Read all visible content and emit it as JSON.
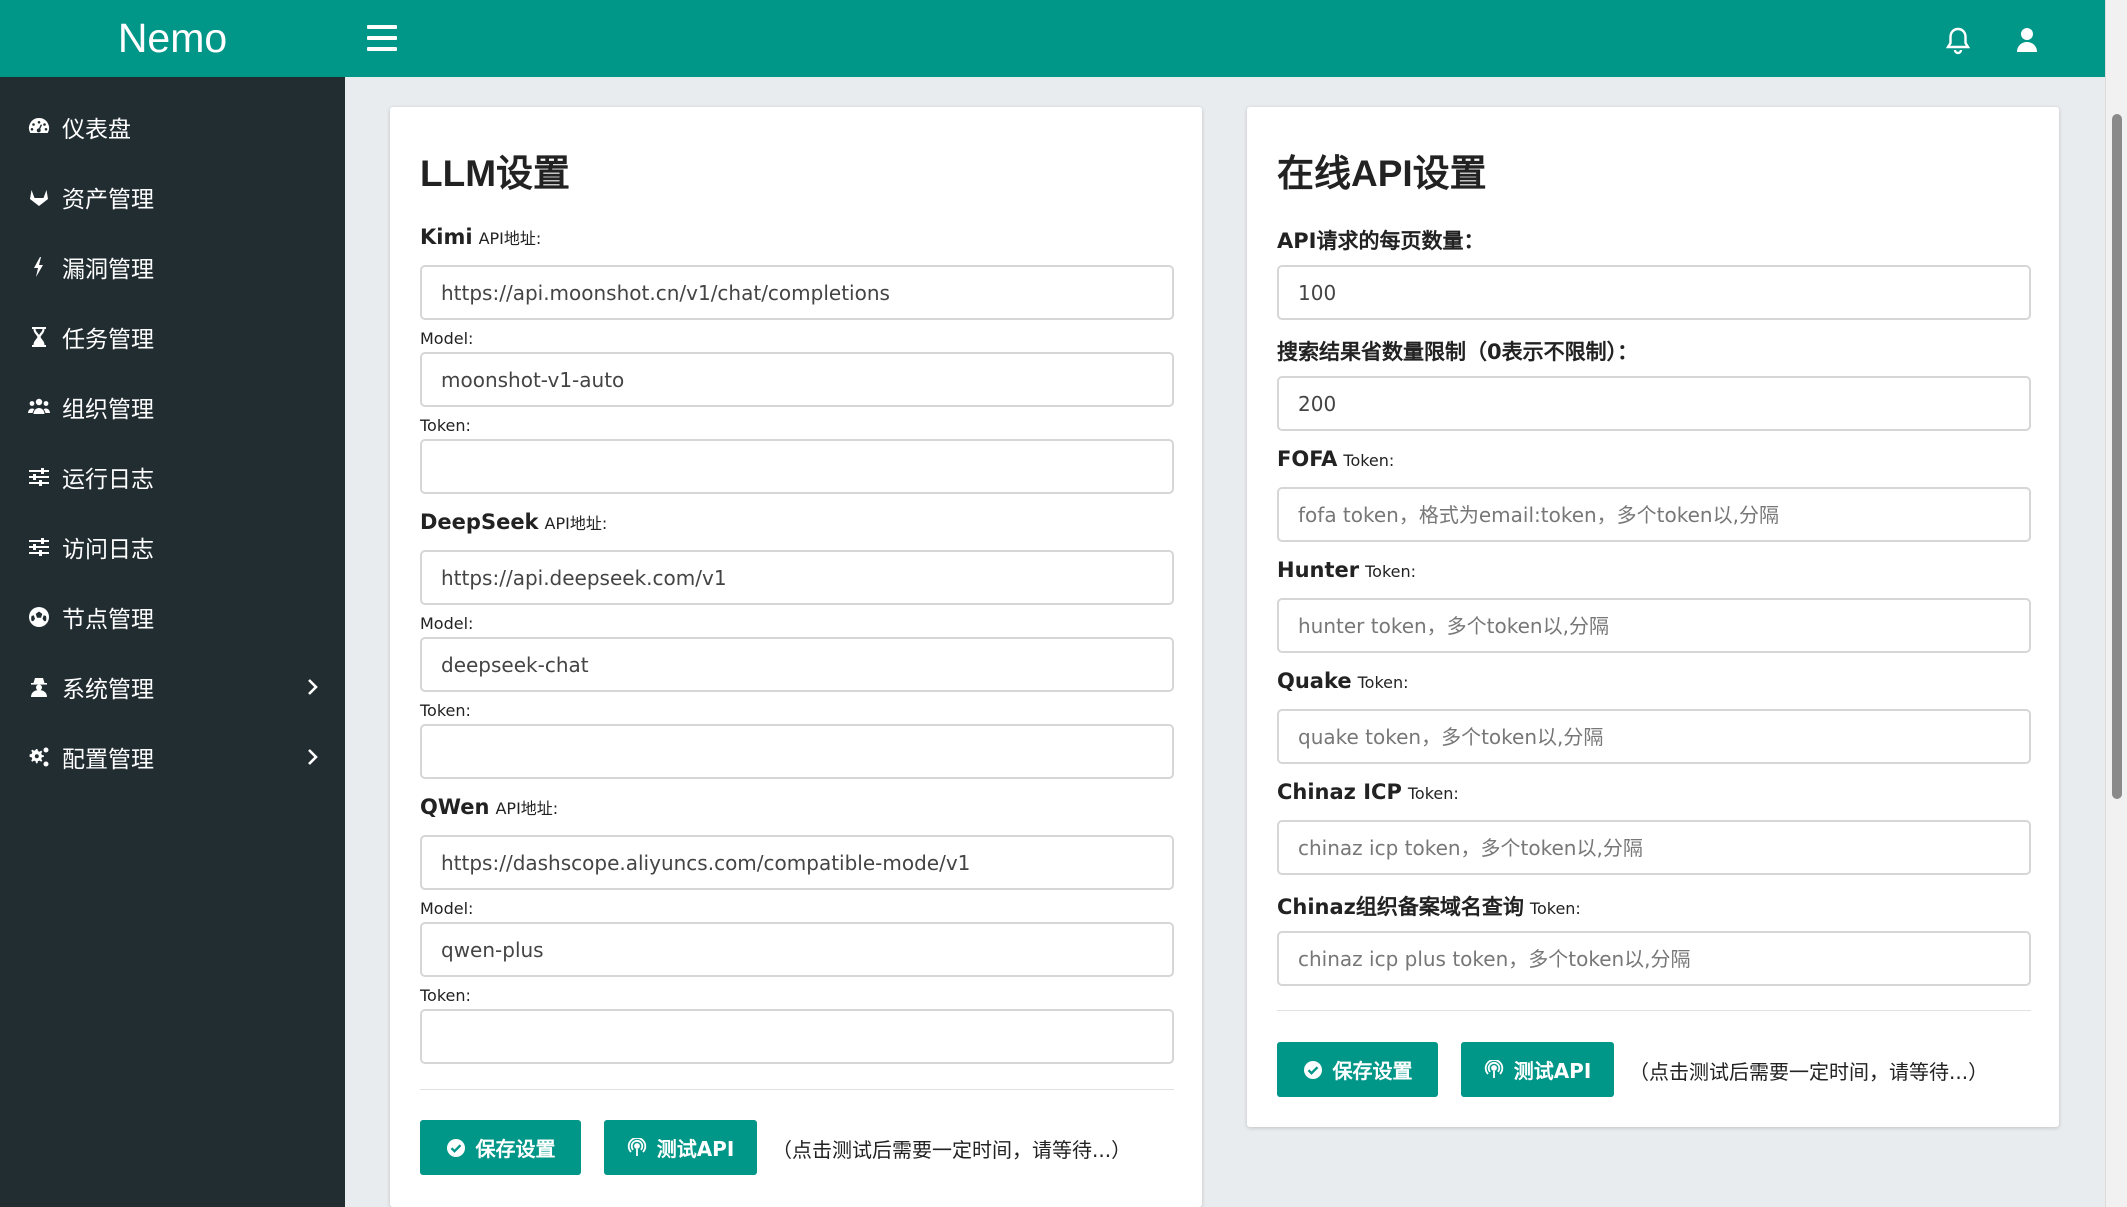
{
  "app": {
    "brand": "Nemo"
  },
  "sidebar": {
    "items": [
      {
        "label": "仪表盘",
        "icon": "dashboard-icon"
      },
      {
        "label": "资产管理",
        "icon": "gitlab-fox-icon"
      },
      {
        "label": "漏洞管理",
        "icon": "bolt-icon"
      },
      {
        "label": "任务管理",
        "icon": "hourglass-icon"
      },
      {
        "label": "组织管理",
        "icon": "users-icon"
      },
      {
        "label": "运行日志",
        "icon": "sliders-icon"
      },
      {
        "label": "访问日志",
        "icon": "sliders-icon"
      },
      {
        "label": "节点管理",
        "icon": "futbol-icon"
      },
      {
        "label": "系统管理",
        "icon": "user-secret-icon"
      },
      {
        "label": "配置管理",
        "icon": "cogs-icon"
      }
    ]
  },
  "llm": {
    "title": "LLM设置",
    "kimi": {
      "name": "Kimi",
      "api_label": "API地址:",
      "api_value": "https://api.moonshot.cn/v1/chat/completions",
      "model_label": "Model:",
      "model_value": "moonshot-v1-auto",
      "token_label": "Token:",
      "token_value": ""
    },
    "deepseek": {
      "name": "DeepSeek",
      "api_label": "API地址:",
      "api_value": "https://api.deepseek.com/v1",
      "model_label": "Model:",
      "model_value": "deepseek-chat",
      "token_label": "Token:",
      "token_value": ""
    },
    "qwen": {
      "name": "QWen",
      "api_label": "API地址:",
      "api_value": "https://dashscope.aliyuncs.com/compatible-mode/v1",
      "model_label": "Model:",
      "model_value": "qwen-plus",
      "token_label": "Token:",
      "token_value": ""
    },
    "save_label": "保存设置",
    "test_label": "测试API",
    "note": "（点击测试后需要一定时间，请等待...）"
  },
  "online": {
    "title": "在线API设置",
    "page_size_label": "API请求的每页数量：",
    "page_size_value": "100",
    "limit_label": "搜索结果省数量限制（0表示不限制）：",
    "limit_value": "200",
    "fofa": {
      "name": "FOFA",
      "sub": "Token:",
      "placeholder": "fofa token，格式为email:token，多个token以,分隔"
    },
    "hunter": {
      "name": "Hunter",
      "sub": "Token:",
      "placeholder": "hunter token，多个token以,分隔"
    },
    "quake": {
      "name": "Quake",
      "sub": "Token:",
      "placeholder": "quake token，多个token以,分隔"
    },
    "chinaz_icp": {
      "name": "Chinaz ICP",
      "sub": "Token:",
      "placeholder": "chinaz icp token，多个token以,分隔"
    },
    "chinaz_org": {
      "name": "Chinaz组织备案域名查询",
      "sub": "Token:",
      "placeholder": "chinaz icp plus token，多个token以,分隔"
    },
    "save_label": "保存设置",
    "test_label": "测试API",
    "note": "（点击测试后需要一定时间，请等待...）"
  },
  "colors": {
    "primary": "#009688",
    "sidebar": "#222d32",
    "background": "#e9ecef"
  }
}
